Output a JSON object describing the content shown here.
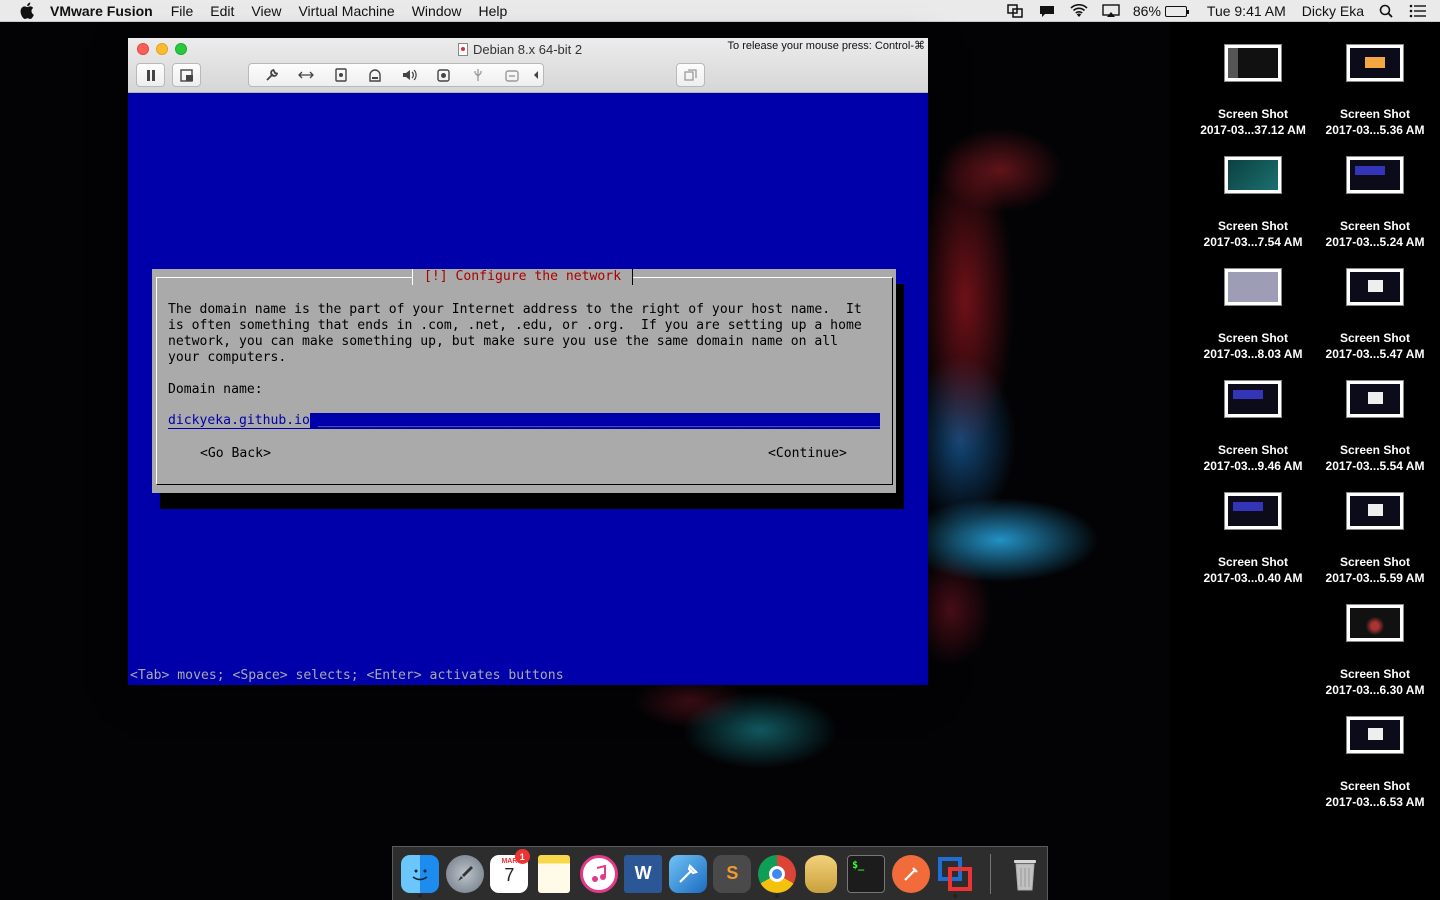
{
  "menubar": {
    "app_name": "VMware Fusion",
    "items": [
      "File",
      "Edit",
      "View",
      "Virtual Machine",
      "Window",
      "Help"
    ],
    "battery_percent": "86%",
    "battery_level": 0.86,
    "clock": "Tue 9:41 AM",
    "user": "Dicky Eka"
  },
  "vm_window": {
    "title": "Debian 8.x 64-bit 2",
    "release_hint": "To release your mouse press: Control-⌘"
  },
  "installer": {
    "dialog_title": "[!] Configure the network",
    "description": "The domain name is the part of your Internet address to the right of your host name.  It\nis often something that ends in .com, .net, .edu, or .org.  If you are setting up a home\nnetwork, you can make something up, but make sure you use the same domain name on all\nyour computers.",
    "field_label": "Domain name:",
    "field_value": "dickyeka.github.io",
    "field_fill": " ________________________________________________________________________________________",
    "go_back": "<Go Back>",
    "continue": "<Continue>",
    "hint": "<Tab> moves; <Space> selects; <Enter> activates buttons"
  },
  "desktop_icons": [
    {
      "line1": "Screen Shot",
      "line2": "2017-03...37.12 AM"
    },
    {
      "line1": "Screen Shot",
      "line2": "2017-03...5.36 AM"
    },
    {
      "line1": "Screen Shot",
      "line2": "2017-03...7.54 AM"
    },
    {
      "line1": "Screen Shot",
      "line2": "2017-03...5.24 AM"
    },
    {
      "line1": "Screen Shot",
      "line2": "2017-03...8.03 AM"
    },
    {
      "line1": "Screen Shot",
      "line2": "2017-03...5.47 AM"
    },
    {
      "line1": "Screen Shot",
      "line2": "2017-03...9.46 AM"
    },
    {
      "line1": "Screen Shot",
      "line2": "2017-03...5.54 AM"
    },
    {
      "line1": "Screen Shot",
      "line2": "2017-03...0.40 AM"
    },
    {
      "line1": "Screen Shot",
      "line2": "2017-03...5.59 AM"
    },
    {
      "line1": "Screen Shot",
      "line2": "2017-03...6.30 AM"
    },
    {
      "line1": "Screen Shot",
      "line2": "2017-03...6.53 AM"
    }
  ],
  "dock": {
    "calendar_month": "MAR",
    "calendar_day": "7",
    "calendar_badge": "1",
    "word_letter": "W",
    "sublime_letter": "S",
    "terminal_text": "$_"
  }
}
